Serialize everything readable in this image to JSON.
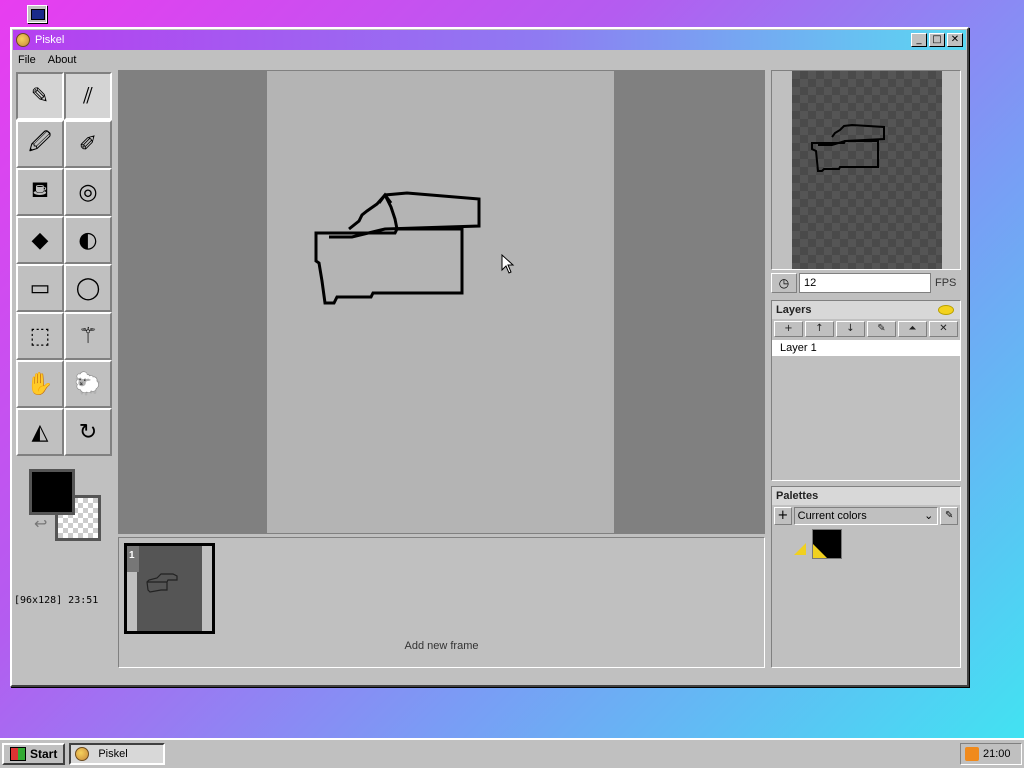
{
  "window": {
    "title": "Piskel",
    "minimize_label": "_",
    "maximize_label": "□",
    "close_label": "✕"
  },
  "menu": {
    "file": "File",
    "about": "About"
  },
  "tools": [
    {
      "name": "pen-tool",
      "glyph": "✎",
      "active": true
    },
    {
      "name": "vertical-mirror-pen-tool",
      "glyph": "⫽",
      "active": true
    },
    {
      "name": "color-picker-tool",
      "glyph": "🖉",
      "active": false
    },
    {
      "name": "stroke-tool",
      "glyph": "✐",
      "active": false
    },
    {
      "name": "paint-bucket-tool",
      "glyph": "⛾",
      "active": false
    },
    {
      "name": "paint-same-color-tool",
      "glyph": "◎",
      "active": false
    },
    {
      "name": "eraser-tool",
      "glyph": "◆",
      "active": false
    },
    {
      "name": "lighten-tool",
      "glyph": "◐",
      "active": false
    },
    {
      "name": "rectangle-tool",
      "glyph": "▭",
      "active": false
    },
    {
      "name": "circle-tool",
      "glyph": "◯",
      "active": false
    },
    {
      "name": "rectangle-select-tool",
      "glyph": "⬚",
      "active": false
    },
    {
      "name": "magic-wand-tool",
      "glyph": "⚚",
      "active": false
    },
    {
      "name": "move-tool",
      "glyph": "✋",
      "active": false
    },
    {
      "name": "shape-select-tool",
      "glyph": "🐑",
      "active": false
    },
    {
      "name": "flip-tool",
      "glyph": "◭",
      "active": false
    },
    {
      "name": "rotate-tool",
      "glyph": "↻",
      "active": false
    }
  ],
  "colors": {
    "primary": "#000000",
    "secondary": "transparent",
    "swap_glyph": "↩"
  },
  "status": {
    "size_and_cursor": "[96x128] 23:51"
  },
  "frames": {
    "items": [
      {
        "number": "1"
      }
    ],
    "add_label": "Add new frame"
  },
  "preview": {
    "fps_value": "12",
    "fps_label": "FPS",
    "fps_icon_glyph": "◷"
  },
  "layers": {
    "title": "Layers",
    "buttons": [
      {
        "name": "add-layer-button",
        "glyph": "+"
      },
      {
        "name": "move-layer-up-button",
        "glyph": "↑"
      },
      {
        "name": "move-layer-down-button",
        "glyph": "↓"
      },
      {
        "name": "edit-layer-button",
        "glyph": "✎"
      },
      {
        "name": "merge-layer-button",
        "glyph": "⏶"
      },
      {
        "name": "delete-layer-button",
        "glyph": "✕"
      }
    ],
    "items": [
      {
        "label": "Layer 1"
      }
    ]
  },
  "palettes": {
    "title": "Palettes",
    "add_glyph": "+",
    "selected": "Current colors",
    "chevron": "⌄",
    "edit_glyph": "✎",
    "swatches": [
      "#000000",
      "#f0d020"
    ]
  },
  "taskbar": {
    "start_label": "Start",
    "task_label": "Piskel",
    "clock": "21:00"
  }
}
